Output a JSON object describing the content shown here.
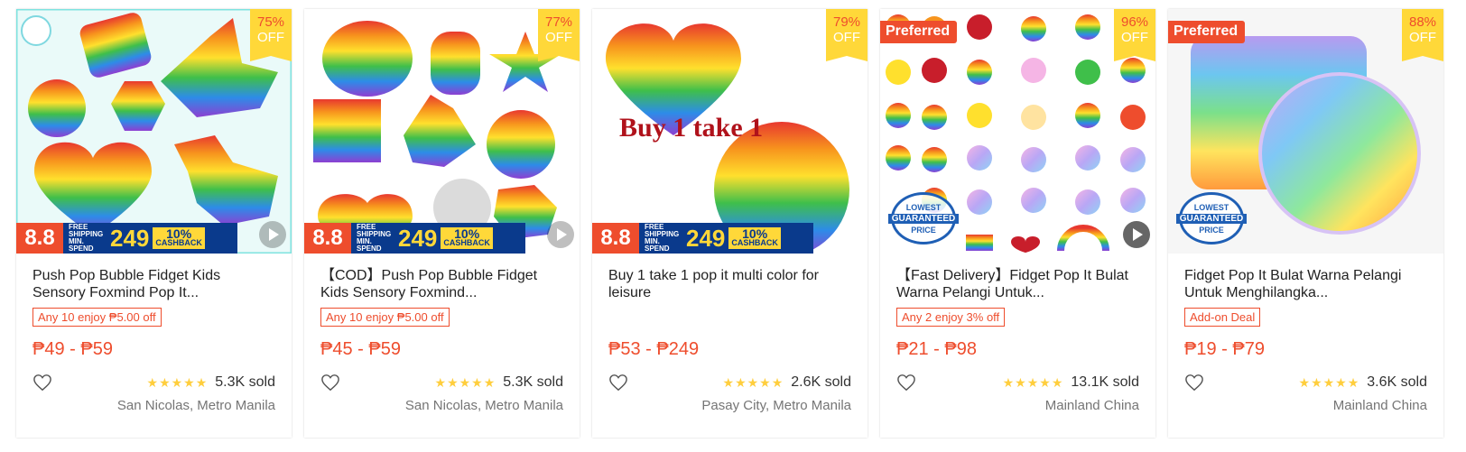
{
  "promo": {
    "eight_eight": "8.8",
    "free_shipping": "FREE SHIPPING MIN. SPEND",
    "amount": "249",
    "cashback_pct": "10%",
    "cashback_label": "CASHBACK"
  },
  "guarantee": {
    "top": "LOWEST",
    "mid": "GUARANTEED",
    "bottom": "PRICE"
  },
  "products": [
    {
      "title": "Push Pop Bubble Fidget Kids Sensory Foxmind Pop It...",
      "discount_pct": "75%",
      "discount_off": "OFF",
      "tag": "Any 10 enjoy ₱5.00 off",
      "price": "₱49 - ₱59",
      "stars": "★★★★★",
      "sold": "5.3K sold",
      "location": "San Nicolas, Metro Manila",
      "image_icon": "rainbow-pop-it-shapes-image"
    },
    {
      "title": "【COD】Push Pop Bubble Fidget Kids Sensory Foxmind...",
      "discount_pct": "77%",
      "discount_off": "OFF",
      "tag": "Any 10 enjoy ₱5.00 off",
      "price": "₱45 - ₱59",
      "stars": "★★★★★",
      "sold": "5.3K sold",
      "location": "San Nicolas, Metro Manila",
      "image_icon": "rainbow-pop-it-collection-image"
    },
    {
      "title": "Buy 1 take 1 pop it multi color for leisure",
      "discount_pct": "79%",
      "discount_off": "OFF",
      "image_text": "Buy 1 take 1",
      "price": "₱53 - ₱249",
      "stars": "★★★★★",
      "sold": "2.6K sold",
      "location": "Pasay City, Metro Manila",
      "image_icon": "heart-and-circle-pop-it-image"
    },
    {
      "title": "【Fast Delivery】Fidget Pop It Bulat Warna Pelangi Untuk...",
      "discount_pct": "96%",
      "discount_off": "OFF",
      "preferred": "Preferred",
      "tag": "Any 2 enjoy 3% off",
      "price": "₱21 - ₱98",
      "stars": "★★★★★",
      "sold": "13.1K sold",
      "location": "Mainland China",
      "image_icon": "pop-it-variants-grid-image"
    },
    {
      "title": "Fidget Pop It Bulat Warna Pelangi Untuk Menghilangka...",
      "discount_pct": "88%",
      "discount_off": "OFF",
      "preferred": "Preferred",
      "tag": "Add-on Deal",
      "price": "₱19 - ₱79",
      "stars": "★★★★★",
      "sold": "3.6K sold",
      "location": "Mainland China",
      "image_icon": "square-and-round-pop-it-image"
    }
  ]
}
